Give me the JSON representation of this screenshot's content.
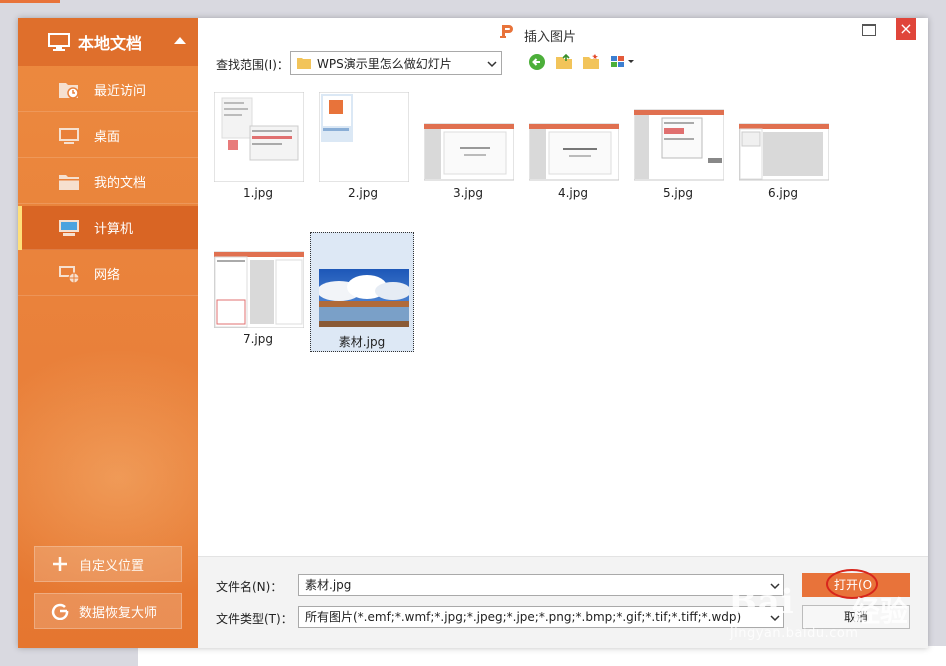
{
  "dialog": {
    "title": "插入图片",
    "close_glyph": "×"
  },
  "sidebar": {
    "header": "本地文档",
    "items": [
      {
        "label": "最近访问",
        "icon": "recent-folder-icon"
      },
      {
        "label": "桌面",
        "icon": "desktop-icon"
      },
      {
        "label": "我的文档",
        "icon": "folder-icon"
      },
      {
        "label": "计算机",
        "icon": "computer-icon"
      },
      {
        "label": "网络",
        "icon": "network-icon"
      }
    ],
    "active_index": 3,
    "custom_location_button": "自定义位置",
    "data_recovery_button": "数据恢复大师"
  },
  "toolbar": {
    "look_in_label": "查找范围(I)：",
    "look_in_value": "WPS演示里怎么做幻灯片"
  },
  "files": [
    {
      "name": "1.jpg"
    },
    {
      "name": "2.jpg"
    },
    {
      "name": "3.jpg"
    },
    {
      "name": "4.jpg"
    },
    {
      "name": "5.jpg"
    },
    {
      "name": "6.jpg"
    },
    {
      "name": "7.jpg"
    },
    {
      "name": "素材.jpg",
      "selected": true
    }
  ],
  "bottom": {
    "filename_label": "文件名(N)：",
    "filename_value": "素材.jpg",
    "filetype_label": "文件类型(T)：",
    "filetype_value": "所有图片(*.emf;*.wmf;*.jpg;*.jpeg;*.jpe;*.png;*.bmp;*.gif;*.tif;*.tiff;*.wdp)",
    "open_button": "打开(O",
    "cancel_button": "取消"
  },
  "watermark": {
    "brand": "Bai",
    "brand_cn": "经验",
    "url": "jingyan.baidu.com"
  },
  "colors": {
    "sidebar_orange": "#e9803a",
    "sidebar_header": "#df6f2c",
    "active_item": "#d96524",
    "close_red": "#e0453a",
    "open_button": "#e8733a"
  }
}
